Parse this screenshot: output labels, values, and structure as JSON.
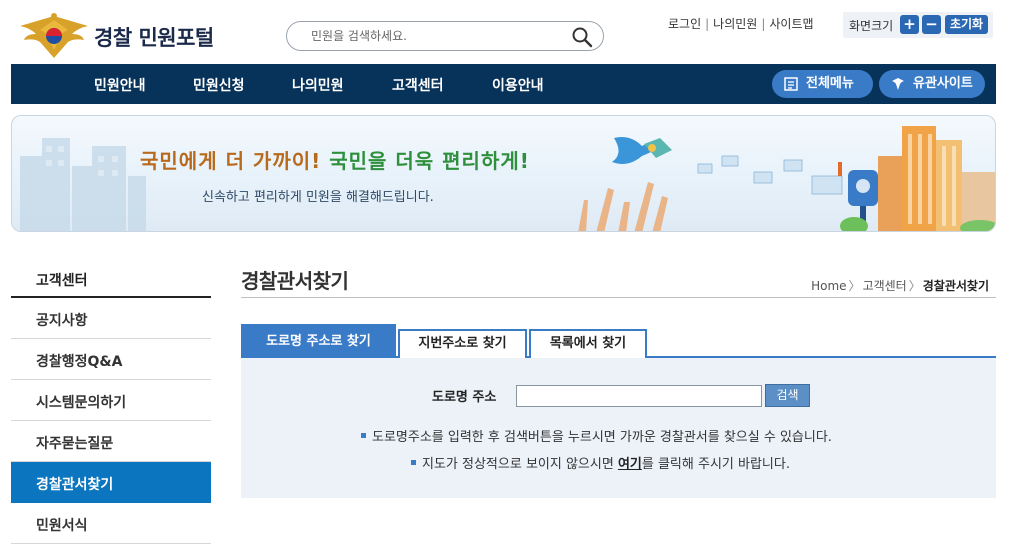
{
  "header": {
    "site_title": "경찰 민원포털",
    "search_placeholder": "민원을 검색하세요.",
    "util_links": [
      "로그인",
      "나의민원",
      "사이트맵"
    ],
    "font_size_label": "화면크기",
    "font_plus": "+",
    "font_minus": "−",
    "font_reset": "초기화"
  },
  "nav": {
    "items": [
      "민원안내",
      "민원신청",
      "나의민원",
      "고객센터",
      "이용안내"
    ],
    "all_menu": "전체메뉴",
    "related_sites": "유관사이트"
  },
  "banner": {
    "headline_part1": "국민에게 더 가까이!",
    "headline_part2": "국민을 더욱 편리하게!",
    "subtitle": "신속하고 편리하게 민원을 해결해드립니다."
  },
  "sidebar": {
    "title": "고객센터",
    "items": [
      {
        "label": "공지사항",
        "active": false
      },
      {
        "label": "경찰행정Q&A",
        "active": false
      },
      {
        "label": "시스템문의하기",
        "active": false
      },
      {
        "label": "자주묻는질문",
        "active": false
      },
      {
        "label": "경찰관서찾기",
        "active": true
      },
      {
        "label": "민원서식",
        "active": false
      }
    ]
  },
  "main": {
    "page_title": "경찰관서찾기",
    "breadcrumb": [
      "Home",
      "고객센터",
      "경찰관서찾기"
    ],
    "tabs": [
      {
        "label": "도로명 주소로 찾기",
        "active": true
      },
      {
        "label": "지번주소로 찾기",
        "active": false
      },
      {
        "label": "목록에서 찾기",
        "active": false
      }
    ],
    "search": {
      "label": "도로명 주소",
      "value": "",
      "button": "검색"
    },
    "note1": "도로명주소를 입력한 후 검색버튼을 누르시면 가까운 경찰관서를 찾으실 수 있습니다.",
    "note2_before": "지도가 정상적으로 보이지 않으시면",
    "note2_link": "여기",
    "note2_after": "를 클릭해 주시기 바랍니다."
  },
  "colors": {
    "navy": "#07325a",
    "accent_blue": "#3a7bc8",
    "active_side": "#0b75bf",
    "headline_orange": "#b86a1c",
    "headline_green": "#2e8f3d",
    "panel_bg": "#ecf2f8"
  },
  "icons": {
    "logo": "police-emblem",
    "search": "search-icon",
    "all_menu": "menu-list-icon",
    "related_sites": "emblem-icon"
  }
}
